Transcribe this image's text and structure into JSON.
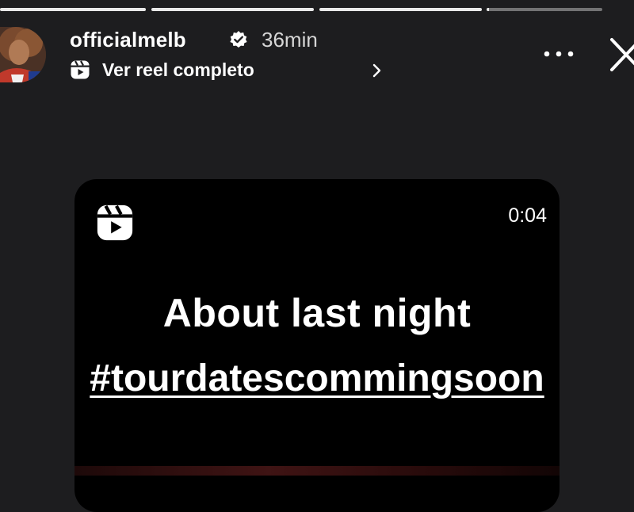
{
  "story": {
    "progress": [
      1,
      1,
      1,
      0.02
    ]
  },
  "header": {
    "username": "officialmelb",
    "timestamp": "36min",
    "reels_link_label": "Ver reel completo",
    "icons": {
      "verified": "verified-badge-icon",
      "reels": "reels-icon",
      "chevron": "chevron-right-icon",
      "more": "more-dots-icon",
      "close": "close-icon"
    }
  },
  "reel": {
    "duration": "0:04",
    "caption_line1": "About last night",
    "caption_line2": "#tourdatescommingsoon",
    "icon": "reels-icon"
  },
  "colors": {
    "background": "#1d1d1f",
    "card": "#000000",
    "text": "#ffffff",
    "progress_track": "rgba(255,255,255,0.38)",
    "progress_fill": "#e9e9e9"
  }
}
